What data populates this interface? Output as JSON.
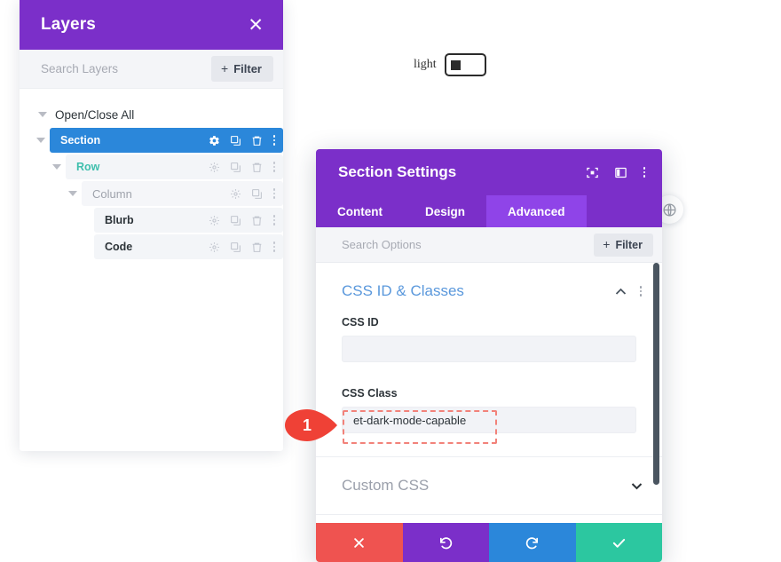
{
  "layers_panel": {
    "title": "Layers",
    "close_icon": "close-icon",
    "search": {
      "placeholder": "Search Layers"
    },
    "filter_label": "Filter",
    "open_close_all": "Open/Close All",
    "tree": [
      {
        "label": "Section",
        "level": 1,
        "state": "selected",
        "tools": [
          "gear-icon",
          "duplicate-icon",
          "trash-icon",
          "more-icon"
        ]
      },
      {
        "label": "Row",
        "level": 2,
        "state": "row",
        "tools": [
          "gear-icon",
          "duplicate-icon",
          "trash-icon",
          "more-icon"
        ]
      },
      {
        "label": "Column",
        "level": 3,
        "state": "column",
        "tools": [
          "gear-icon",
          "duplicate-icon",
          "more-icon"
        ]
      },
      {
        "label": "Blurb",
        "level": 4,
        "state": "module",
        "tools": [
          "gear-icon",
          "duplicate-icon",
          "trash-icon",
          "more-icon"
        ]
      },
      {
        "label": "Code",
        "level": 4,
        "state": "module",
        "tools": [
          "gear-icon",
          "duplicate-icon",
          "trash-icon",
          "more-icon"
        ]
      }
    ]
  },
  "light_toggle": {
    "label": "light",
    "state": "off"
  },
  "globe_button": {
    "icon": "globe-icon"
  },
  "modal": {
    "title": "Section Settings",
    "header_icons": [
      "focus-icon",
      "layout-icon",
      "more-icon"
    ],
    "tabs": [
      {
        "label": "Content",
        "active": false
      },
      {
        "label": "Design",
        "active": false
      },
      {
        "label": "Advanced",
        "active": true
      }
    ],
    "search": {
      "placeholder": "Search Options"
    },
    "filter_label": "Filter",
    "sections": {
      "css_id_classes": {
        "title": "CSS ID & Classes",
        "expanded": true,
        "fields": [
          {
            "label": "CSS ID",
            "value": "",
            "placeholder": ""
          },
          {
            "label": "CSS Class",
            "value": "et-dark-mode-capable",
            "placeholder": ""
          }
        ]
      },
      "custom_css": {
        "title": "Custom CSS",
        "expanded": false
      }
    },
    "footer_buttons": [
      {
        "name": "cancel",
        "icon": "close-icon",
        "color": "#ef5350"
      },
      {
        "name": "undo",
        "icon": "undo-icon",
        "color": "#7b2fc9"
      },
      {
        "name": "redo",
        "icon": "redo-icon",
        "color": "#2b87da"
      },
      {
        "name": "save",
        "icon": "check-icon",
        "color": "#2cc7a0"
      }
    ]
  },
  "annotation": {
    "marker_number": "1",
    "marker_color": "#ef4136",
    "highlight_color": "#f2827a"
  }
}
